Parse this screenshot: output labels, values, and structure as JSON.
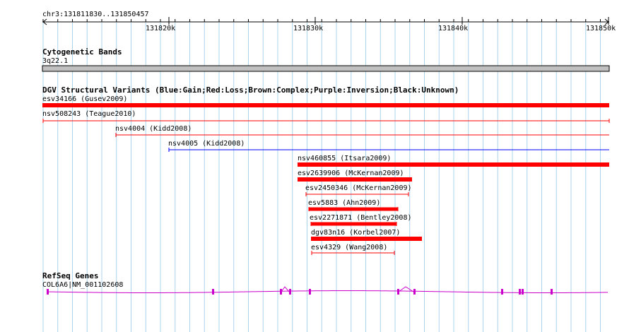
{
  "ruler": {
    "position_label": "chr3:131811830..131850457",
    "ticks": [
      "131820k",
      "131830k",
      "131840k",
      "131850k"
    ]
  },
  "cytoband": {
    "title": "Cytogenetic Bands",
    "band_label": "3q22.1",
    "band_color": "#c0c0c0"
  },
  "dgv": {
    "title": "DGV Structural Variants (Blue:Gain;Red:Loss;Brown:Complex;Purple:Inversion;Black:Unknown)",
    "colors": {
      "gain": "#0000ff",
      "loss": "#ff0000"
    },
    "variants": [
      {
        "label": "esv34166 (Gusev2009)",
        "type": "loss"
      },
      {
        "label": "nsv508243 (Teague2010)",
        "type": "loss"
      },
      {
        "label": "nsv4004 (Kidd2008)",
        "type": "loss"
      },
      {
        "label": "nsv4005 (Kidd2008)",
        "type": "gain"
      },
      {
        "label": "nsv460855 (Itsara2009)",
        "type": "loss"
      },
      {
        "label": "esv2639906 (McKernan2009)",
        "type": "loss"
      },
      {
        "label": "esv2450346 (McKernan2009)",
        "type": "loss"
      },
      {
        "label": "esv5883 (Ahn2009)",
        "type": "loss"
      },
      {
        "label": "esv2271871 (Bentley2008)",
        "type": "loss"
      },
      {
        "label": "dgv83n16 (Korbel2007)",
        "type": "loss"
      },
      {
        "label": "esv4329 (Wang2008)",
        "type": "loss"
      }
    ]
  },
  "refseq": {
    "title": "RefSeq Genes",
    "gene_label": "COL6A6|NM_001102608",
    "gene_color": "#cc00cc"
  }
}
